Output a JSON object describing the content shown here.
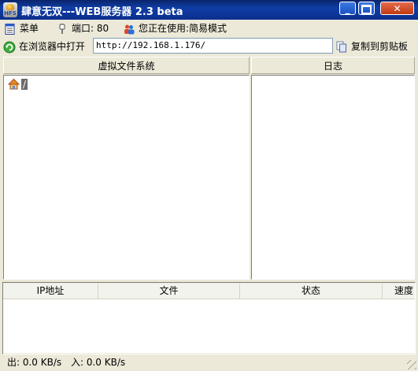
{
  "window": {
    "title": "肆意无双---WEB服务器 2.3 beta",
    "icon_text": "HFS",
    "min_label": "_",
    "close_label": "✕"
  },
  "toolbar": {
    "menu_label": "菜单",
    "port_label": "端口: 80",
    "mode_label": "您正在使用:简易模式"
  },
  "urlbar": {
    "open_browser_label": "在浏览器中打开",
    "url_value": "http://192.168.1.176/",
    "copy_label": "复制到剪贴板"
  },
  "panels": {
    "vfs_header": "虚拟文件系统",
    "log_header": "日志",
    "vfs_root_label": "/"
  },
  "connections": {
    "columns": [
      "IP地址",
      "文件",
      "状态",
      "速度"
    ]
  },
  "statusbar": {
    "out": "出: 0.0 KB/s",
    "in": "入: 0.0 KB/s"
  }
}
